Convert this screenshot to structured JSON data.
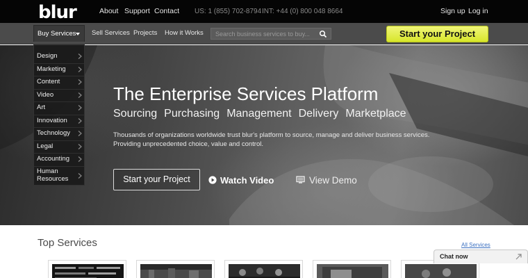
{
  "topbar": {
    "logo": "blur",
    "links": [
      "About",
      "Support",
      "Contact"
    ],
    "phone_us": "US: 1 (855) 702-8794",
    "phone_int": "INT: +44 (0) 800 048 8664",
    "signup": "Sign up",
    "login": "Log in"
  },
  "navbar": {
    "buy_services": "Buy Services",
    "links": [
      "Sell Services",
      "Projects",
      "How it Works"
    ],
    "search_placeholder": "Search business services to buy...",
    "start_project": "Start your Project"
  },
  "dropdown": {
    "items": [
      "Design",
      "Marketing",
      "Content",
      "Video",
      "Art",
      "Innovation",
      "Technology",
      "Legal",
      "Accounting"
    ],
    "last_item": [
      "Human",
      "Resources"
    ]
  },
  "hero": {
    "title": "The Enterprise Services Platform",
    "tags": [
      "Sourcing",
      "Purchasing",
      "Management",
      "Delivery",
      "Marketplace"
    ],
    "desc_line1": "Thousands of organizations worldwide trust blur's platform to source, manage and deliver business services.",
    "desc_line2": "Providing unprecedented choice, value and control.",
    "start_project": "Start your Project",
    "watch_video": "Watch Video",
    "view_demo": "View Demo"
  },
  "services": {
    "heading": "Top Services",
    "all_link": "All Services"
  },
  "chat": {
    "label": "Chat now"
  },
  "colors": {
    "accent_yellow": "#e3ee3c",
    "top_bar": "#050505",
    "nav_bar": "#4b4b4b",
    "link_blue": "#3a6fc0"
  }
}
